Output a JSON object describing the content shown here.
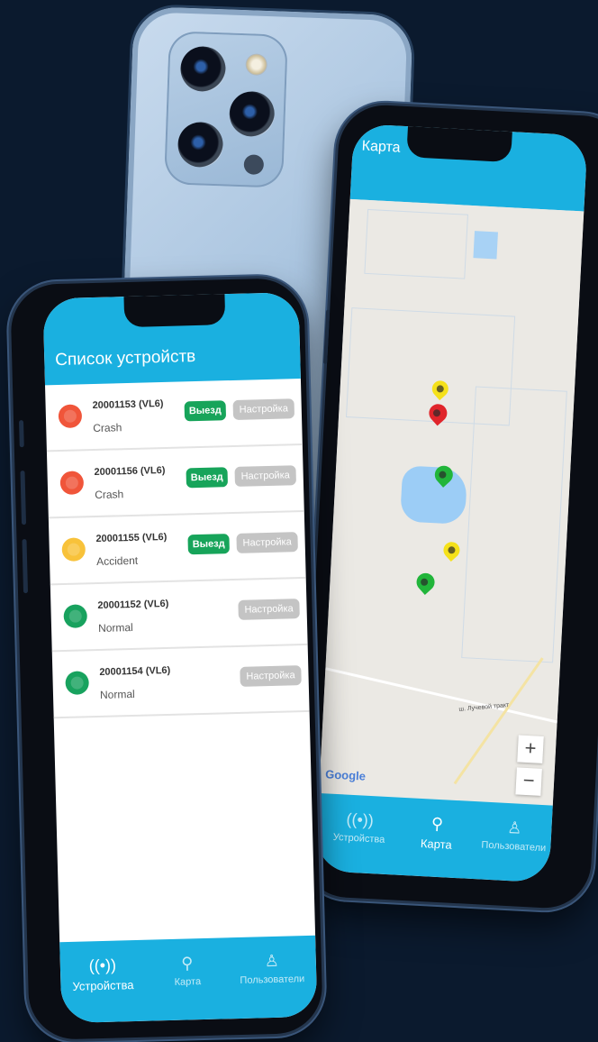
{
  "devices_screen": {
    "title": "Список устройств",
    "devices": [
      {
        "id": "20001153 (VL6)",
        "status": "Crash",
        "color": "#f0553a",
        "go_label": "Выезд",
        "settings_label": "Настройка"
      },
      {
        "id": "20001156 (VL6)",
        "status": "Crash",
        "color": "#f0553a",
        "go_label": "Выезд",
        "settings_label": "Настройка"
      },
      {
        "id": "20001155 (VL6)",
        "status": "Accident",
        "color": "#f8c23a",
        "go_label": "Выезд",
        "settings_label": "Настройка"
      },
      {
        "id": "20001152 (VL6)",
        "status": "Normal",
        "color": "#18a25e",
        "go_label": "",
        "settings_label": "Настройка"
      },
      {
        "id": "20001154 (VL6)",
        "status": "Normal",
        "color": "#18a25e",
        "go_label": "",
        "settings_label": "Настройка"
      }
    ],
    "tabs": [
      {
        "label": "Устройства",
        "icon": "antenna-icon",
        "active": true
      },
      {
        "label": "Карта",
        "icon": "map-pin-icon",
        "active": false
      },
      {
        "label": "Пользователи",
        "icon": "user-icon",
        "active": false
      }
    ]
  },
  "map_screen": {
    "title": "Карта",
    "zoom_in": "+",
    "zoom_out": "−",
    "attribution": "Google",
    "road_label": "ш. Лучевой тракт",
    "pins": [
      {
        "color": "#f5e11a"
      },
      {
        "color": "#e0252b"
      },
      {
        "color": "#21b53a"
      },
      {
        "color": "#f5e11a"
      },
      {
        "color": "#21b53a"
      }
    ],
    "tabs": [
      {
        "label": "Устройства",
        "icon": "antenna-icon",
        "active": false
      },
      {
        "label": "Карта",
        "icon": "map-pin-icon",
        "active": true
      },
      {
        "label": "Пользователи",
        "icon": "user-icon",
        "active": false
      }
    ]
  },
  "colors": {
    "brand": "#1ab0e0",
    "background": "#0b1a2e"
  }
}
